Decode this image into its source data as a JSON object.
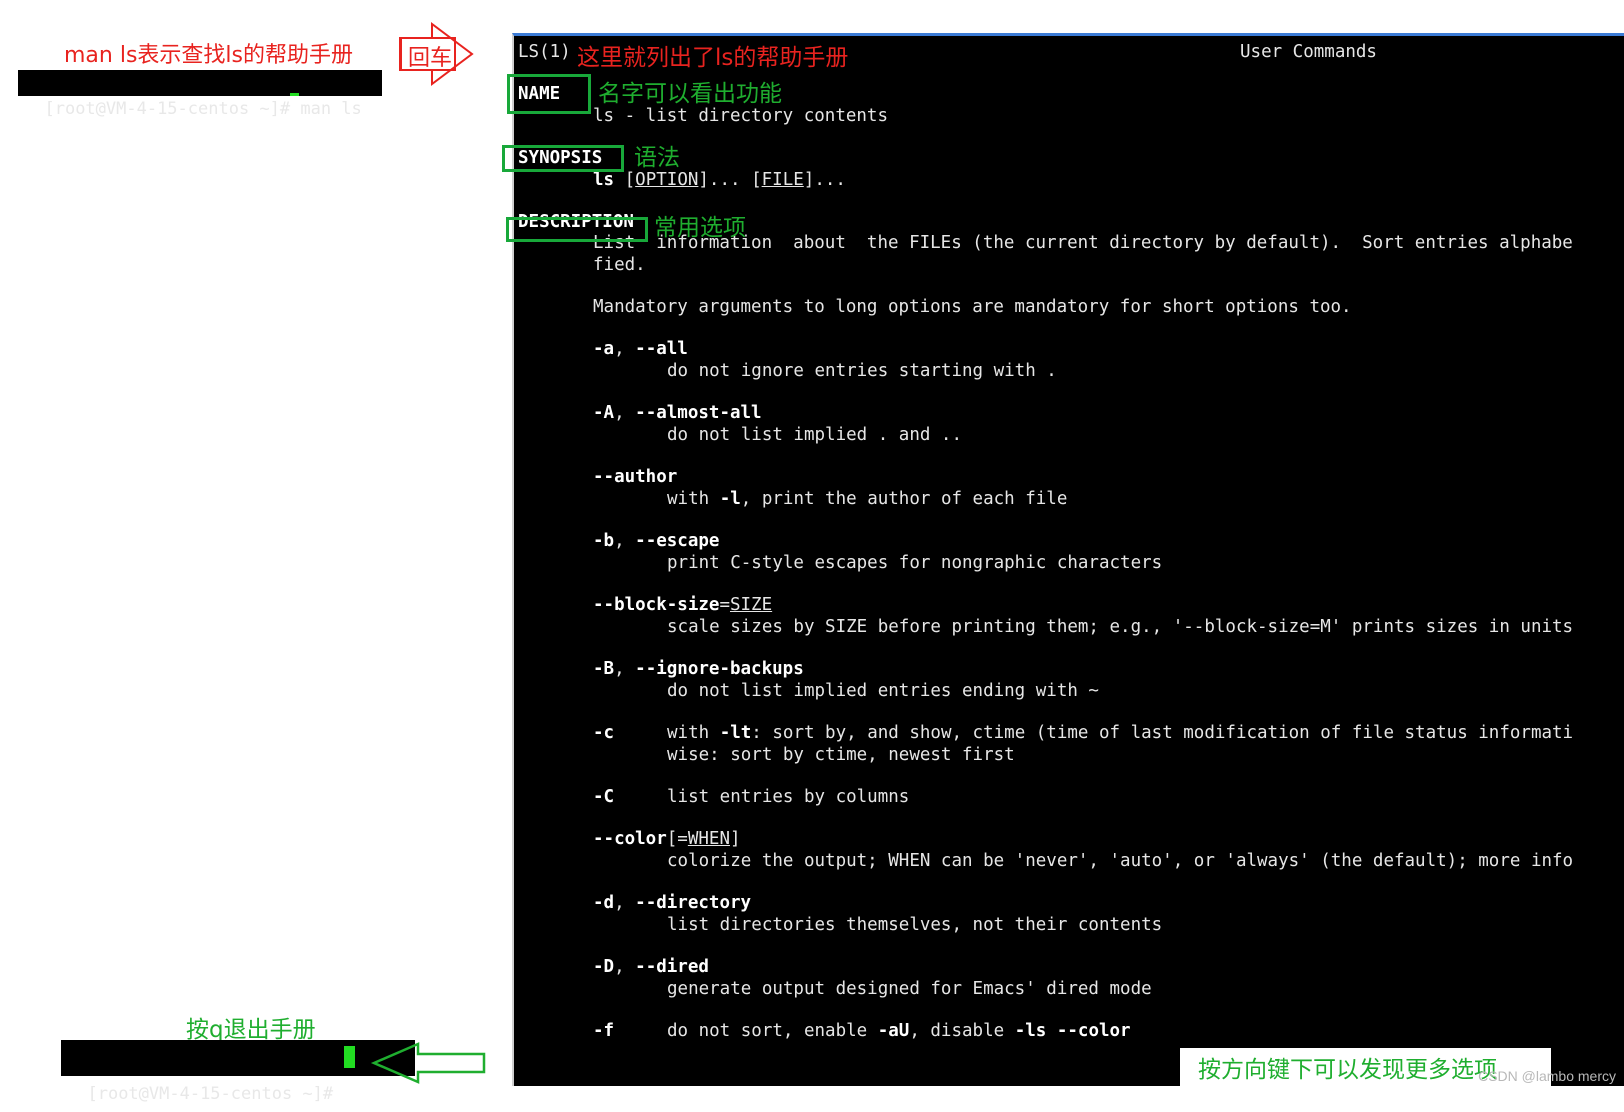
{
  "annotations": {
    "man_cmd_desc": "man ls表示查找ls的帮助手册",
    "enter_label": "回车",
    "manual_listed": "这里就列出了ls的帮助手册",
    "name_note": "名字可以看出功能",
    "synopsis_note": "语法",
    "description_note": "常用选项",
    "quit_note": "按q退出手册",
    "scroll_note": "按方向键下可以发现更多选项"
  },
  "top_prompt": {
    "prompt": "[root@VM-4-15-centos ~]# ",
    "command": "man ls"
  },
  "bottom_prompt": {
    "prompt": "[root@VM-4-15-centos ~]# "
  },
  "man": {
    "header_left": "LS(1)",
    "header_right": "User Commands",
    "name_heading": "NAME",
    "name_line": "ls - list directory contents",
    "synopsis_heading": "SYNOPSIS",
    "syn_cmd": "ls",
    "syn_sp": " ",
    "syn_open1": "[",
    "syn_option": "OPTION",
    "syn_close1": "]... ",
    "syn_open2": "[",
    "syn_file": "FILE",
    "syn_close2": "]...",
    "description_heading": "DESCRIPTION",
    "desc_line1": "List  information  about  the FILEs (the current directory by default).  Sort entries alphabe",
    "desc_line2": "fied.",
    "desc_line3": "Mandatory arguments to long options are mandatory for short options too.",
    "opt_a": "-a",
    "opt_a_sep": ", ",
    "opt_a_long": "--all",
    "opt_a_desc": "do not ignore entries starting with .",
    "opt_A": "-A",
    "opt_A_sep": ", ",
    "opt_A_long": "--almost-all",
    "opt_A_desc": "do not list implied . and ..",
    "opt_author": "--author",
    "opt_author_d1": "with ",
    "opt_author_d2": "-l",
    "opt_author_d3": ", print the author of each file",
    "opt_b": "-b",
    "opt_b_sep": ", ",
    "opt_b_long": "--escape",
    "opt_b_desc": "print C-style escapes for nongraphic characters",
    "opt_bs": "--block-size",
    "opt_bs_eq": "=",
    "opt_bs_arg": "SIZE",
    "opt_bs_desc": "scale sizes by SIZE before printing them; e.g., '--block-size=M' prints sizes in units",
    "opt_B": "-B",
    "opt_B_sep": ", ",
    "opt_B_long": "--ignore-backups",
    "opt_B_desc": "do not list implied entries ending with ~",
    "opt_c": "-c",
    "opt_c_d1": "with ",
    "opt_c_d2": "-lt",
    "opt_c_d3": ": sort by, and show, ctime (time of last modification of file status informati",
    "opt_c_d4": "wise: sort by ctime, newest first",
    "opt_C": "-C",
    "opt_C_desc": "list entries by columns",
    "opt_color": "--color",
    "opt_color_o": "[=",
    "opt_color_arg": "WHEN",
    "opt_color_c": "]",
    "opt_color_desc": "colorize the output; WHEN can be 'never', 'auto', or 'always' (the default); more info",
    "opt_d": "-d",
    "opt_d_sep": ", ",
    "opt_d_long": "--directory",
    "opt_d_desc": "list directories themselves, not their contents",
    "opt_D": "-D",
    "opt_D_sep": ", ",
    "opt_D_long": "--dired",
    "opt_D_desc": "generate output designed for Emacs' dired mode",
    "opt_f": "-f",
    "opt_f_d1": "do not sort, enable ",
    "opt_f_d2": "-aU",
    "opt_f_d3": ", disable ",
    "opt_f_d4": "-ls --color"
  },
  "watermark": "CSDN @lambo mercy",
  "colors": {
    "annotation_red": "#e8231f",
    "annotation_green": "#1fae2f",
    "cursor_green": "#22dd22",
    "title_bar_blue": "#3b7bd6"
  }
}
